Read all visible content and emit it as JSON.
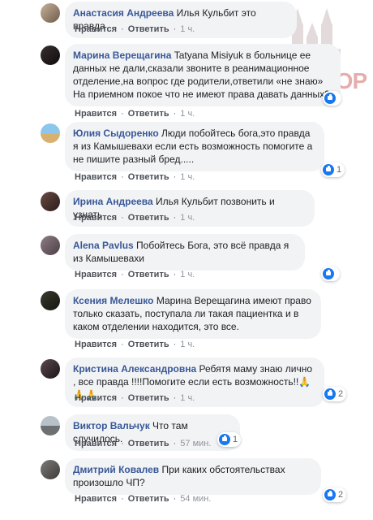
{
  "actions": {
    "like": "Нравится",
    "reply": "Ответить"
  },
  "watermark": {
    "text": "ЗБОР"
  },
  "comments": [
    {
      "author": "Анастасия Андреева",
      "text": "Илья Кульбит это правда",
      "time": "1 ч.",
      "reactions": ""
    },
    {
      "author": "Марина Верещагина",
      "text": "Tatyana Misiyuk в больнице ее данных не дали,сказали звоните в реанимационное отделение,на вопрос где родители,ответили «не знаю» На приемном покое что не имеют права давать данных?",
      "time": "1 ч.",
      "reactions": ""
    },
    {
      "author": "Юлия Сыдоренко",
      "text": "Люди побойтесь бога,это правда я из Камышевахи если есть возможность помогите а не пишите разный бред.....",
      "time": "1 ч.",
      "reactions": "1"
    },
    {
      "author": "Ирина Андреева",
      "text": "Илья Кульбит позвонить и узнать",
      "time": "1 ч.",
      "reactions": ""
    },
    {
      "author": "Alena Pavlus",
      "text": "Побойтесь Бога, это всё правда я из Камышевахи",
      "time": "1 ч.",
      "reactions": ""
    },
    {
      "author": "Ксения Мелешко",
      "text": "Марина Верещагина имеют право только сказать, поступала ли такая пациентка и в каком отделении находится, это все.",
      "time": "1 ч.",
      "reactions": ""
    },
    {
      "author": "Кристина Александровна",
      "text": "Ребятя маму знаю лично , все правда !!!!Помогите если есть возможность!!🙏🙏🙏",
      "time": "1 ч.",
      "reactions": "2"
    },
    {
      "author": "Виктор Вальчук",
      "text": "Что там случилось.",
      "time": "57 мин.",
      "reactions": "1"
    },
    {
      "author": "Дмитрий Ковалев",
      "text": "При каких обстоятельствах произошло ЧП?",
      "time": "54 мин.",
      "reactions": "2"
    }
  ]
}
